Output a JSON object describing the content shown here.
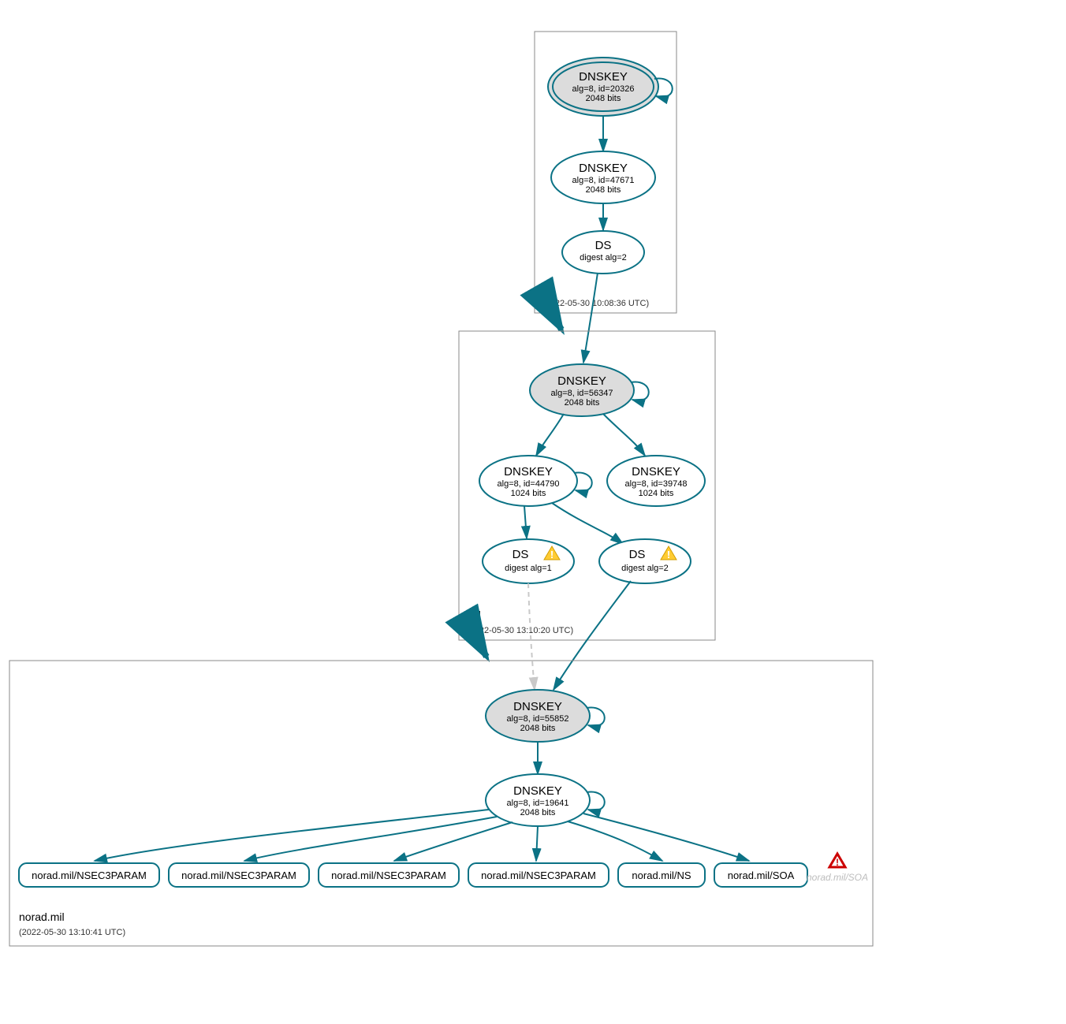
{
  "colors": {
    "teal": "#0b7285",
    "node_fill_gray": "#dcdcdc",
    "box_stroke": "#888888",
    "dash_gray": "#c9c9c9",
    "warn_fill": "#ffcc33",
    "error_stroke": "#cc0000"
  },
  "zones": [
    {
      "id": "root",
      "label": ".",
      "timestamp": "(2022-05-30 10:08:36 UTC)",
      "nodes": [
        {
          "id": "root-ksk",
          "title": "DNSKEY",
          "line2": "alg=8, id=20326",
          "line3": "2048 bits",
          "double_border": true,
          "filled": true,
          "self_loop": true
        },
        {
          "id": "root-zsk",
          "title": "DNSKEY",
          "line2": "alg=8, id=47671",
          "line3": "2048 bits",
          "double_border": false,
          "filled": false,
          "self_loop": false
        },
        {
          "id": "root-ds",
          "title": "DS",
          "line2": "digest alg=2",
          "line3": "",
          "double_border": false,
          "filled": false,
          "self_loop": false
        }
      ]
    },
    {
      "id": "mil",
      "label": "mil",
      "timestamp": "(2022-05-30 13:10:20 UTC)",
      "nodes": [
        {
          "id": "mil-ksk",
          "title": "DNSKEY",
          "line2": "alg=8, id=56347",
          "line3": "2048 bits",
          "double_border": false,
          "filled": true,
          "self_loop": true
        },
        {
          "id": "mil-zsk1",
          "title": "DNSKEY",
          "line2": "alg=8, id=44790",
          "line3": "1024 bits",
          "double_border": false,
          "filled": false,
          "self_loop": true
        },
        {
          "id": "mil-zsk2",
          "title": "DNSKEY",
          "line2": "alg=8, id=39748",
          "line3": "1024 bits",
          "double_border": false,
          "filled": false,
          "self_loop": false
        },
        {
          "id": "mil-ds1",
          "title": "DS",
          "line2": "digest alg=1",
          "line3": "",
          "warning": true,
          "double_border": false,
          "filled": false
        },
        {
          "id": "mil-ds2",
          "title": "DS",
          "line2": "digest alg=2",
          "line3": "",
          "warning": true,
          "double_border": false,
          "filled": false
        }
      ]
    },
    {
      "id": "norad",
      "label": "norad.mil",
      "timestamp": "(2022-05-30 13:10:41 UTC)",
      "nodes": [
        {
          "id": "norad-ksk",
          "title": "DNSKEY",
          "line2": "alg=8, id=55852",
          "line3": "2048 bits",
          "double_border": false,
          "filled": true,
          "self_loop": true
        },
        {
          "id": "norad-zsk",
          "title": "DNSKEY",
          "line2": "alg=8, id=19641",
          "line3": "2048 bits",
          "double_border": false,
          "filled": false,
          "self_loop": true
        }
      ],
      "rrsets": [
        {
          "id": "rr1",
          "label": "norad.mil/NSEC3PARAM"
        },
        {
          "id": "rr2",
          "label": "norad.mil/NSEC3PARAM"
        },
        {
          "id": "rr3",
          "label": "norad.mil/NSEC3PARAM"
        },
        {
          "id": "rr4",
          "label": "norad.mil/NSEC3PARAM"
        },
        {
          "id": "rr5",
          "label": "norad.mil/NS"
        },
        {
          "id": "rr6",
          "label": "norad.mil/SOA"
        }
      ],
      "ghost": {
        "label": "norad.mil/SOA",
        "error": true
      }
    }
  ]
}
